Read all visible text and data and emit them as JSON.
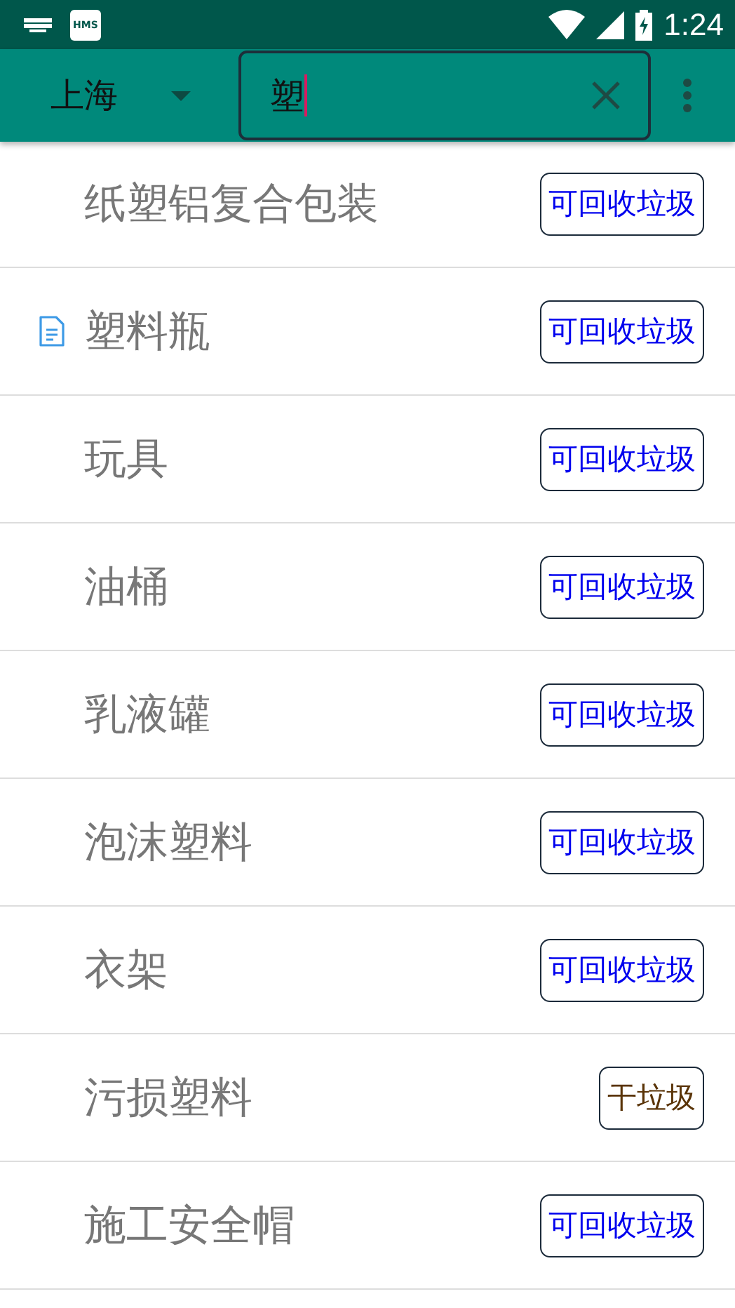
{
  "status_bar": {
    "time": "1:24",
    "app_badge": "HMS"
  },
  "toolbar": {
    "city": "上海",
    "search": {
      "value": "塑"
    }
  },
  "items": [
    {
      "name": "纸塑铝复合包装",
      "document": false,
      "category": {
        "label": "可回收垃圾",
        "kind": "recyclable"
      }
    },
    {
      "name": "塑料瓶",
      "document": true,
      "category": {
        "label": "可回收垃圾",
        "kind": "recyclable"
      }
    },
    {
      "name": "玩具",
      "document": false,
      "category": {
        "label": "可回收垃圾",
        "kind": "recyclable"
      }
    },
    {
      "name": "油桶",
      "document": false,
      "category": {
        "label": "可回收垃圾",
        "kind": "recyclable"
      }
    },
    {
      "name": "乳液罐",
      "document": false,
      "category": {
        "label": "可回收垃圾",
        "kind": "recyclable"
      }
    },
    {
      "name": "泡沫塑料",
      "document": false,
      "category": {
        "label": "可回收垃圾",
        "kind": "recyclable"
      }
    },
    {
      "name": "衣架",
      "document": false,
      "category": {
        "label": "可回收垃圾",
        "kind": "recyclable"
      }
    },
    {
      "name": "污损塑料",
      "document": false,
      "category": {
        "label": "干垃圾",
        "kind": "dry"
      }
    },
    {
      "name": "施工安全帽",
      "document": false,
      "category": {
        "label": "可回收垃圾",
        "kind": "recyclable"
      }
    }
  ]
}
